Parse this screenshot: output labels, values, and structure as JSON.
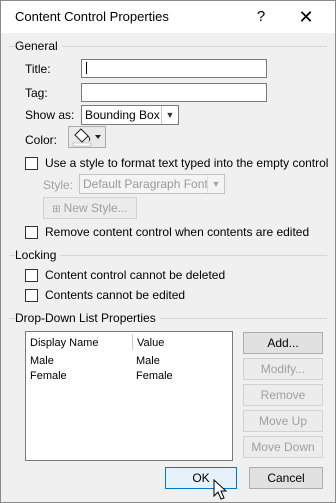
{
  "dialog": {
    "title": "Content Control Properties",
    "help": "?",
    "close": "✕"
  },
  "general": {
    "heading": "General",
    "title_label": "Title:",
    "title_value": "",
    "tag_label": "Tag:",
    "tag_value": "",
    "show_as_label": "Show as:",
    "show_as_value": "Bounding Box",
    "color_label": "Color:",
    "use_style_label": "Use a style to format text typed into the empty control",
    "style_label": "Style:",
    "style_value": "Default Paragraph Font",
    "new_style_label": "New Style...",
    "remove_label": "Remove content control when contents are edited"
  },
  "locking": {
    "heading": "Locking",
    "cannot_delete_label": "Content control cannot be deleted",
    "cannot_edit_label": "Contents cannot be edited"
  },
  "dropdown": {
    "heading": "Drop-Down List Properties",
    "columns": [
      "Display Name",
      "Value"
    ],
    "rows": [
      {
        "display": "Male",
        "value": "Male"
      },
      {
        "display": "Female",
        "value": "Female"
      }
    ],
    "buttons": {
      "add": "Add...",
      "modify": "Modify...",
      "remove": "Remove",
      "move_up": "Move Up",
      "move_down": "Move Down"
    }
  },
  "footer": {
    "ok": "OK",
    "cancel": "Cancel"
  }
}
